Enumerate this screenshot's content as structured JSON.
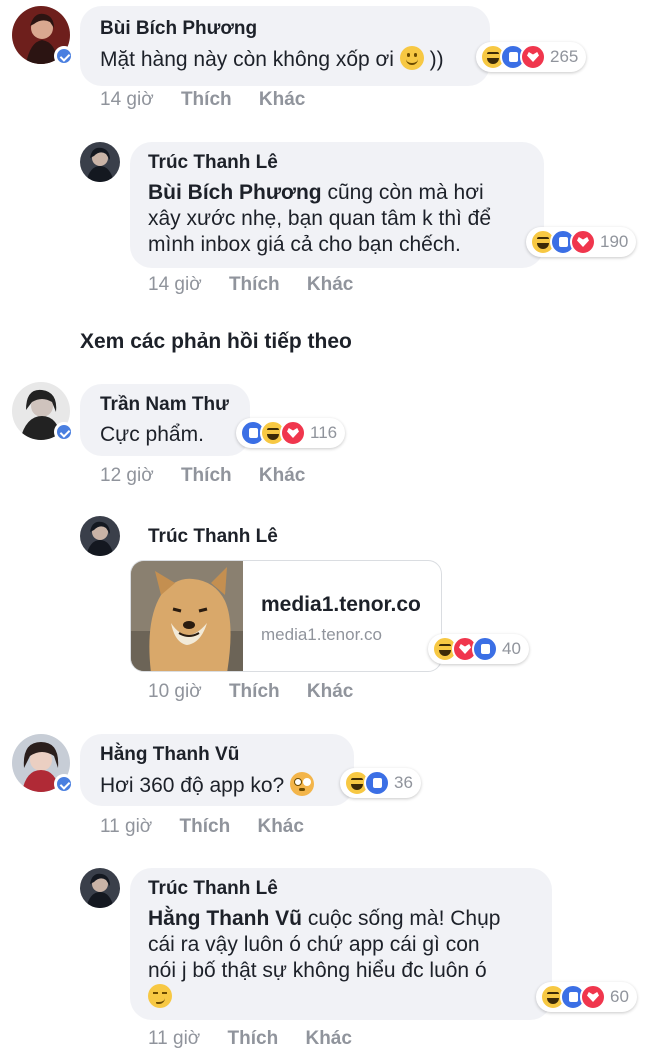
{
  "comments": [
    {
      "author": "Bùi Bích Phương",
      "text": "Mặt hàng này còn không xốp ơi",
      "text_suffix": "))",
      "time": "14 giờ",
      "like_label": "Thích",
      "more_label": "Khác",
      "reaction_count": "265",
      "reactions": [
        "haha",
        "like",
        "love"
      ],
      "replies": [
        {
          "author": "Trúc Thanh Lê",
          "mention": "Bùi Bích Phương",
          "text_lines": [
            " cũng còn mà hơi",
            "xây xước nhẹ, bạn quan tâm k thì để",
            "mình inbox giá cả cho bạn chếch."
          ],
          "time": "14 giờ",
          "like_label": "Thích",
          "more_label": "Khác",
          "reaction_count": "190",
          "reactions": [
            "haha",
            "like",
            "love"
          ]
        }
      ]
    },
    {
      "author": "Trần Nam Thư",
      "text": "Cực phẩm.",
      "time": "12 giờ",
      "like_label": "Thích",
      "more_label": "Khác",
      "reaction_count": "116",
      "reactions": [
        "like",
        "haha",
        "love"
      ],
      "replies": [
        {
          "author": "Trúc Thanh Lê",
          "link_title": "media1.tenor.co",
          "link_domain": "media1.tenor.co",
          "time": "10 giờ",
          "like_label": "Thích",
          "more_label": "Khác",
          "reaction_count": "40",
          "reactions": [
            "haha",
            "love",
            "like"
          ]
        }
      ]
    },
    {
      "author": "Hằng Thanh Vũ",
      "text": "Hơi 360 độ app ko?",
      "time": "11 giờ",
      "like_label": "Thích",
      "more_label": "Khác",
      "reaction_count": "36",
      "reactions": [
        "haha",
        "like"
      ],
      "replies": [
        {
          "author": "Trúc Thanh Lê",
          "mention": "Hằng Thanh Vũ",
          "text_lines": [
            " cuộc sống mà! Chụp",
            "cái ra vậy luôn ó chứ app cái gì con",
            "nói j bố thật sự không hiểu đc luôn ó"
          ],
          "time": "11 giờ",
          "like_label": "Thích",
          "more_label": "Khác",
          "reaction_count": "60",
          "reactions": [
            "haha",
            "like",
            "love"
          ]
        }
      ]
    }
  ],
  "see_more_replies": "Xem các phản hồi tiếp theo",
  "colors": {
    "bubble": "#f1f2f6",
    "meta": "#90949c",
    "like": "#3b6fe5",
    "love": "#f0364d",
    "haha": "#f7c843"
  }
}
